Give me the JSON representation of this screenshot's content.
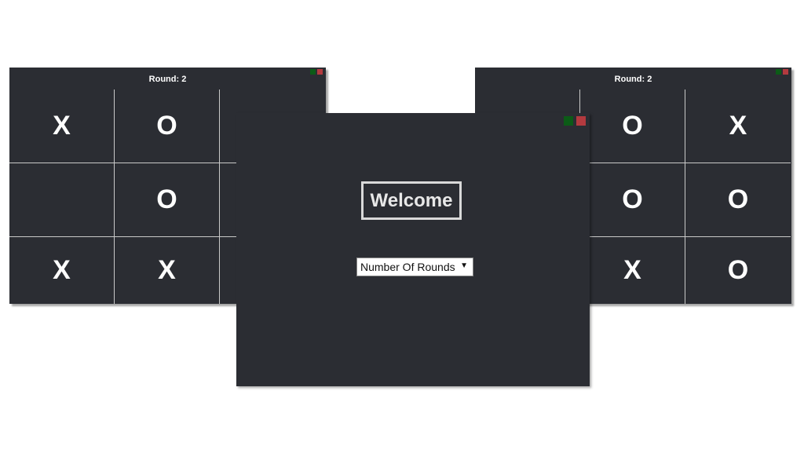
{
  "left_board": {
    "round_label": "Round: 2",
    "cells": [
      "X",
      "O",
      "",
      "",
      "O",
      "",
      "X",
      "X",
      ""
    ]
  },
  "right_board": {
    "round_label": "Round: 2",
    "cells": [
      "",
      "O",
      "X",
      "",
      "O",
      "O",
      "",
      "X",
      "O"
    ]
  },
  "welcome": {
    "title": "Welcome",
    "rounds_select": {
      "selected": "Number Of Rounds"
    }
  },
  "colors": {
    "panel_bg": "#2b2d33",
    "minimize": "#0c5b17",
    "close": "#b33a3f"
  }
}
